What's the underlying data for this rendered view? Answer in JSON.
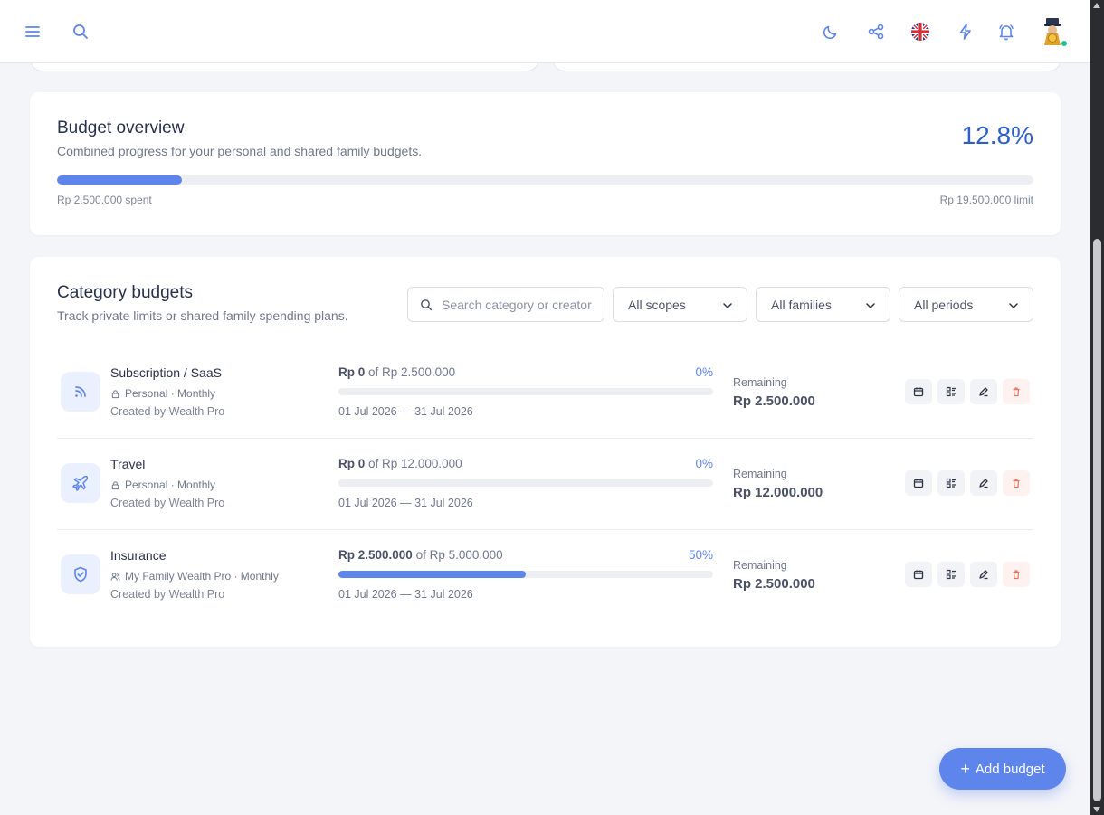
{
  "header": {
    "icons": [
      "menu-icon",
      "search-icon",
      "moon-icon",
      "share-icon",
      "uk-flag-icon",
      "lightning-icon",
      "bell-icon",
      "avatar"
    ]
  },
  "overview": {
    "title": "Budget overview",
    "subtitle": "Combined progress for your personal and shared family budgets.",
    "percent": "12.8%",
    "progress": 0.128,
    "spent": "Rp 2.500.000 spent",
    "limit": "Rp 19.500.000 limit"
  },
  "categories": {
    "title": "Category budgets",
    "subtitle": "Track private limits or shared family spending plans.",
    "search_placeholder": "Search category or creator",
    "filters": [
      "All scopes",
      "All families",
      "All periods"
    ],
    "rows": [
      {
        "icon": "rss-icon",
        "name": "Subscription / SaaS",
        "scope_icon": "lock-icon",
        "meta": "Personal · Monthly",
        "created": "Created by Wealth Pro",
        "spent": "Rp 0",
        "of_total": "of Rp 2.500.000",
        "percent": "0%",
        "progress": 0,
        "dates": "01 Jul 2026 — 31 Jul 2026",
        "remaining_label": "Remaining",
        "remaining": "Rp 2.500.000"
      },
      {
        "icon": "plane-icon",
        "name": "Travel",
        "scope_icon": "lock-icon",
        "meta": "Personal · Monthly",
        "created": "Created by Wealth Pro",
        "spent": "Rp 0",
        "of_total": "of Rp 12.000.000",
        "percent": "0%",
        "progress": 0,
        "dates": "01 Jul 2026 — 31 Jul 2026",
        "remaining_label": "Remaining",
        "remaining": "Rp 12.000.000"
      },
      {
        "icon": "shield-check-icon",
        "name": "Insurance",
        "scope_icon": "users-icon",
        "meta": "My Family Wealth Pro · Monthly",
        "created": "Created by Wealth Pro",
        "spent": "Rp 2.500.000",
        "of_total": "of Rp 5.000.000",
        "percent": "50%",
        "progress": 0.5,
        "dates": "01 Jul 2026 — 31 Jul 2026",
        "remaining_label": "Remaining",
        "remaining": "Rp 2.500.000"
      }
    ],
    "row_actions": [
      "calendar-icon",
      "transactions-icon",
      "edit-icon",
      "trash-icon"
    ]
  },
  "fab": {
    "label": "Add budget"
  },
  "colors": {
    "accent": "#5e85ec",
    "percent_text": "#2e5fc9",
    "danger": "#e8735f"
  }
}
